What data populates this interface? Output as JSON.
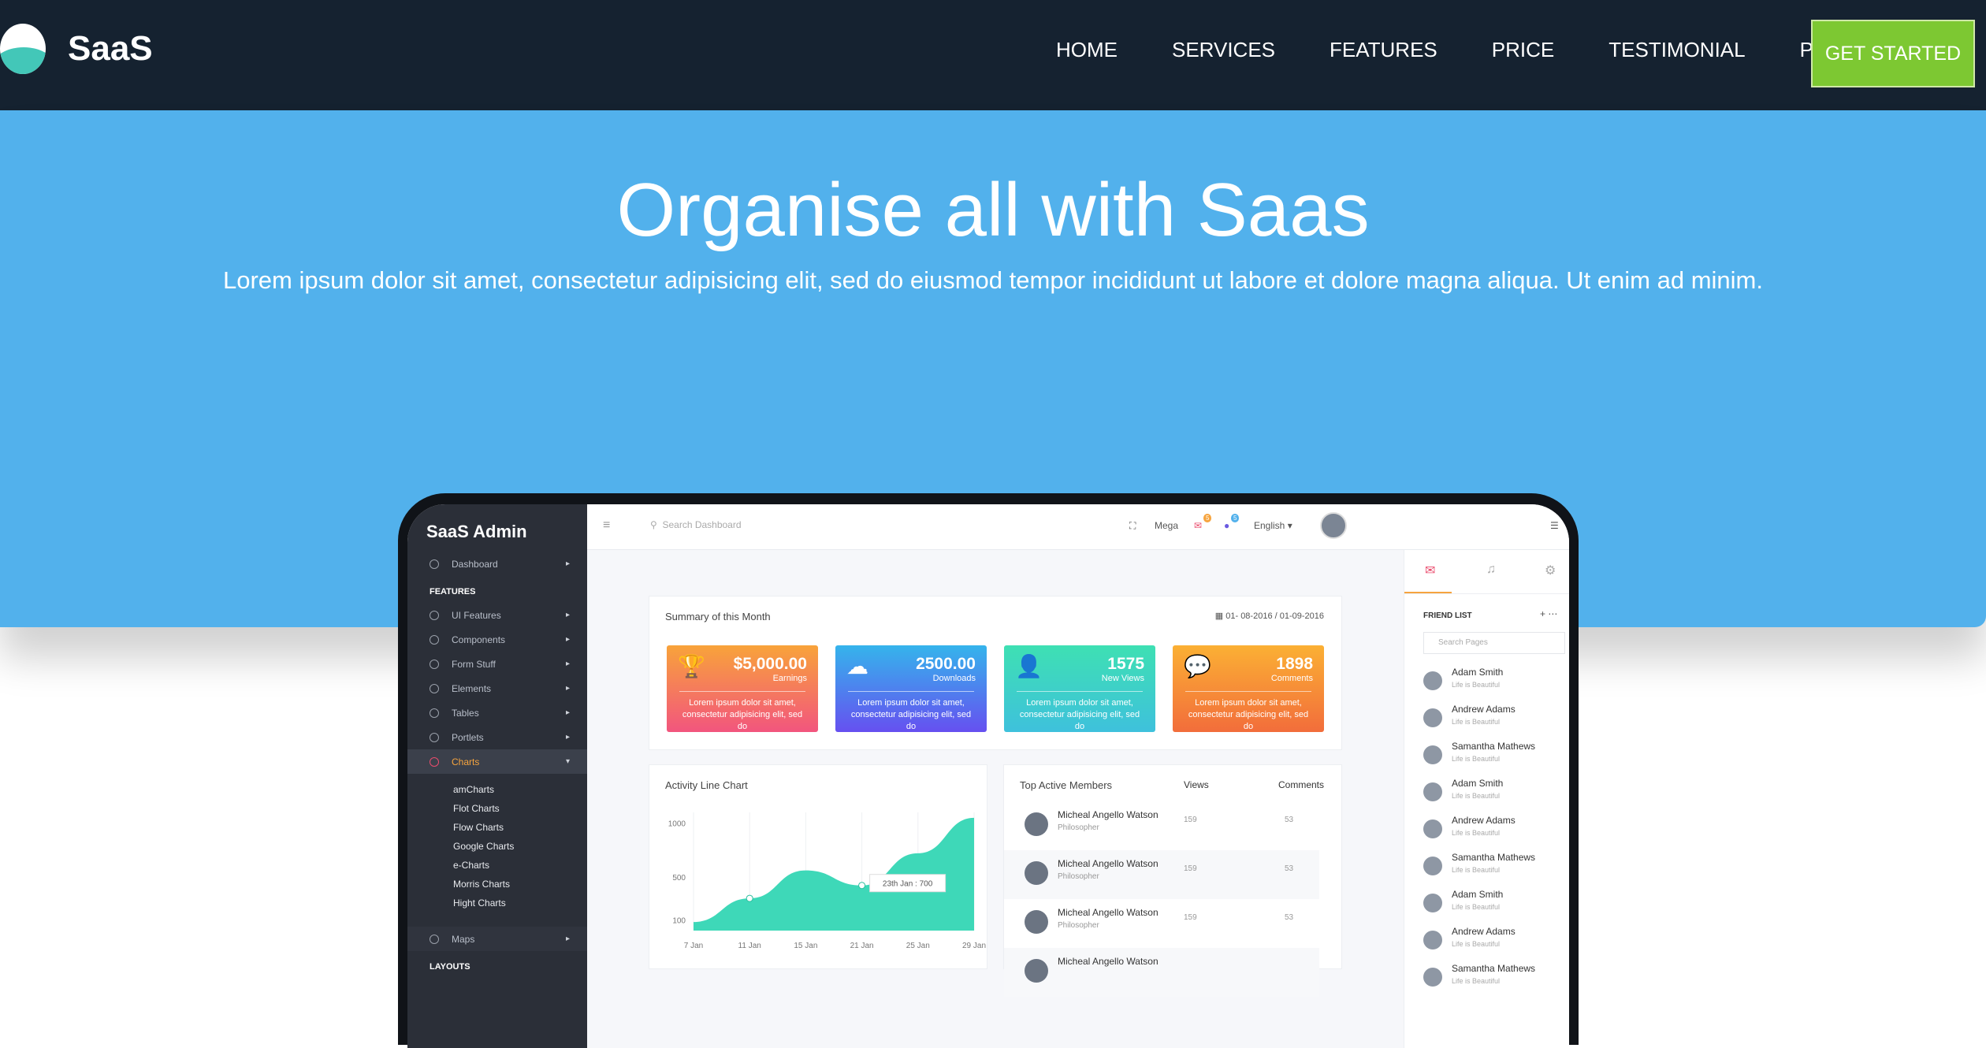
{
  "nav": {
    "brand": "SaaS",
    "links": [
      "HOME",
      "SERVICES",
      "FEATURES",
      "PRICE",
      "TESTIMONIAL",
      "PAGES"
    ],
    "cta": "GET STARTED"
  },
  "hero": {
    "title": "Organise all with Saas",
    "subtitle": "Lorem ipsum dolor sit amet, consectetur adipisicing elit, sed do eiusmod tempor incididunt ut labore et dolore magna aliqua. Ut enim ad minim."
  },
  "dashboard": {
    "brand": "SaaS Admin",
    "search_placeholder": "Search Dashboard",
    "topbar": {
      "mega": "Mega",
      "language": "English ▾",
      "badge1": "5",
      "badge2": "5"
    },
    "sidebar": {
      "dashboard": "Dashboard",
      "section_features": "FEATURES",
      "items": [
        "UI Features",
        "Components",
        "Form Stuff",
        "Elements",
        "Tables",
        "Portlets",
        "Charts"
      ],
      "chart_sub": [
        "amCharts",
        "Flot Charts",
        "Flow Charts",
        "Google Charts",
        "e-Charts",
        "Morris Charts",
        "Hight Charts"
      ],
      "maps": "Maps",
      "section_layouts": "LAYOUTS"
    },
    "summary": {
      "title": "Summary of this Month",
      "dates": "01- 08-2016 / 01-09-2016",
      "cards": [
        {
          "value": "$5,000.00",
          "label": "Earnings",
          "desc": "Lorem ipsum dolor sit amet, consectetur adipisicing elit, sed do",
          "icon": "trophy-icon"
        },
        {
          "value": "2500.00",
          "label": "Downloads",
          "desc": "Lorem ipsum dolor sit amet, consectetur adipisicing elit, sed do",
          "icon": "cloud-download-icon"
        },
        {
          "value": "1575",
          "label": "New Views",
          "desc": "Lorem ipsum dolor sit amet, consectetur adipisicing elit, sed do",
          "icon": "user-icon"
        },
        {
          "value": "1898",
          "label": "Comments",
          "desc": "Lorem ipsum dolor sit amet, consectetur adipisicing elit, sed do",
          "icon": "chat-icon"
        }
      ]
    },
    "activity_title": "Activity Line Chart",
    "tooltip": "23th Jan : 700",
    "members": {
      "title": "Top Active Members",
      "col_views": "Views",
      "col_comments": "Comments",
      "rows": [
        {
          "name": "Micheal Angello Watson",
          "role": "Philosopher",
          "views": "159",
          "comments": "53"
        },
        {
          "name": "Micheal Angello Watson",
          "role": "Philosopher",
          "views": "159",
          "comments": "53"
        },
        {
          "name": "Micheal Angello Watson",
          "role": "Philosopher",
          "views": "159",
          "comments": "53"
        },
        {
          "name": "Micheal Angello Watson",
          "role": "",
          "views": "",
          "comments": ""
        }
      ]
    },
    "friends": {
      "title": "FRIEND LIST",
      "search_placeholder": "Search Pages",
      "list": [
        {
          "name": "Adam Smith",
          "sub": "Life is Beautiful"
        },
        {
          "name": "Andrew Adams",
          "sub": "Life is Beautiful"
        },
        {
          "name": "Samantha Mathews",
          "sub": "Life is Beautiful"
        },
        {
          "name": "Adam Smith",
          "sub": "Life is Beautiful"
        },
        {
          "name": "Andrew Adams",
          "sub": "Life is Beautiful"
        },
        {
          "name": "Samantha Mathews",
          "sub": "Life is Beautiful"
        },
        {
          "name": "Adam Smith",
          "sub": "Life is Beautiful"
        },
        {
          "name": "Andrew Adams",
          "sub": "Life is Beautiful"
        },
        {
          "name": "Samantha Mathews",
          "sub": "Life is Beautiful"
        }
      ]
    }
  },
  "chart_data": {
    "type": "area",
    "title": "Activity Line Chart",
    "x": [
      "7 Jan",
      "11 Jan",
      "15 Jan",
      "21 Jan",
      "25 Jan",
      "29 Jan"
    ],
    "y_ticks": [
      "1000",
      "500",
      "100"
    ],
    "series": [
      {
        "values": [
          80,
          300,
          560,
          420,
          720,
          1050
        ]
      }
    ],
    "color": "#3ed8b8"
  }
}
